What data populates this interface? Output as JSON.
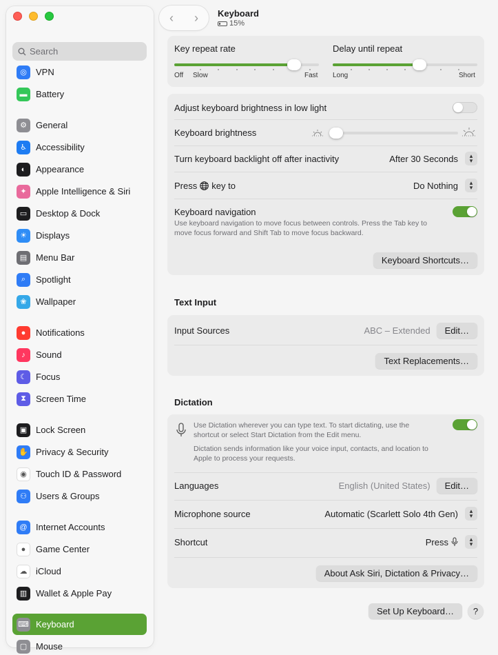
{
  "window": {
    "title": "Keyboard",
    "battery": "15%"
  },
  "sidebar": {
    "search_placeholder": "Search",
    "items": [
      {
        "label": "VPN",
        "color": "#2f7cf6"
      },
      {
        "label": "Battery",
        "color": "#34c759"
      },
      {
        "label": "General",
        "color": "#8e8e93"
      },
      {
        "label": "Accessibility",
        "color": "#1e7cf2"
      },
      {
        "label": "Appearance",
        "color": "#1d1d1f"
      },
      {
        "label": "Apple Intelligence & Siri",
        "color": "#e96a9c"
      },
      {
        "label": "Desktop & Dock",
        "color": "#1d1d1f"
      },
      {
        "label": "Displays",
        "color": "#2f8df6"
      },
      {
        "label": "Menu Bar",
        "color": "#6e6e73"
      },
      {
        "label": "Spotlight",
        "color": "#2f7cf6"
      },
      {
        "label": "Wallpaper",
        "color": "#35a8e8"
      },
      {
        "label": "Notifications",
        "color": "#ff3b30"
      },
      {
        "label": "Sound",
        "color": "#ff375f"
      },
      {
        "label": "Focus",
        "color": "#5e5ce6"
      },
      {
        "label": "Screen Time",
        "color": "#5e5ce6"
      },
      {
        "label": "Lock Screen",
        "color": "#1d1d1f"
      },
      {
        "label": "Privacy & Security",
        "color": "#2f7cf6"
      },
      {
        "label": "Touch ID & Password",
        "color": "#ffffff"
      },
      {
        "label": "Users & Groups",
        "color": "#2f7cf6"
      },
      {
        "label": "Internet Accounts",
        "color": "#2f7cf6"
      },
      {
        "label": "Game Center",
        "color": "#ffffff"
      },
      {
        "label": "iCloud",
        "color": "#ffffff"
      },
      {
        "label": "Wallet & Apple Pay",
        "color": "#1d1d1f"
      },
      {
        "label": "Keyboard",
        "color": "#8e8e93"
      },
      {
        "label": "Mouse",
        "color": "#8e8e93"
      }
    ]
  },
  "repeat": {
    "key_repeat_label": "Key repeat rate",
    "key_repeat_ticks": [
      "Off",
      "Slow",
      "Fast"
    ],
    "key_repeat_value": 0.83,
    "delay_label": "Delay until repeat",
    "delay_ticks": [
      "Long",
      "Short"
    ],
    "delay_value": 0.6
  },
  "backlight": {
    "low_light_label": "Adjust keyboard brightness in low light",
    "low_light_on": false,
    "brightness_label": "Keyboard brightness",
    "brightness_value": 0.05,
    "off_after_label": "Turn keyboard backlight off after inactivity",
    "off_after_value": "After 30 Seconds",
    "press_key_prefix": "Press",
    "press_key_suffix": "key to",
    "press_key_value": "Do Nothing",
    "nav_label": "Keyboard navigation",
    "nav_desc": "Use keyboard navigation to move focus between controls. Press the Tab key to move focus forward and Shift Tab to move focus backward.",
    "nav_on": true,
    "shortcuts_button": "Keyboard Shortcuts…"
  },
  "text_input": {
    "title": "Text Input",
    "input_sources_label": "Input Sources",
    "input_sources_value": "ABC – Extended",
    "edit_button": "Edit…",
    "text_replacements_button": "Text Replacements…"
  },
  "dictation": {
    "title": "Dictation",
    "desc1": "Use Dictation wherever you can type text. To start dictating, use the shortcut or select Start Dictation from the Edit menu.",
    "desc2": "Dictation sends information like your voice input, contacts, and location to Apple to process your requests.",
    "enabled": true,
    "languages_label": "Languages",
    "languages_value": "English (United States)",
    "edit_button": "Edit…",
    "mic_label": "Microphone source",
    "mic_value": "Automatic (Scarlett Solo 4th Gen)",
    "shortcut_label": "Shortcut",
    "shortcut_value": "Press",
    "about_button": "About Ask Siri, Dictation & Privacy…"
  },
  "footer": {
    "setup_button": "Set Up Keyboard…",
    "help_button": "?"
  }
}
